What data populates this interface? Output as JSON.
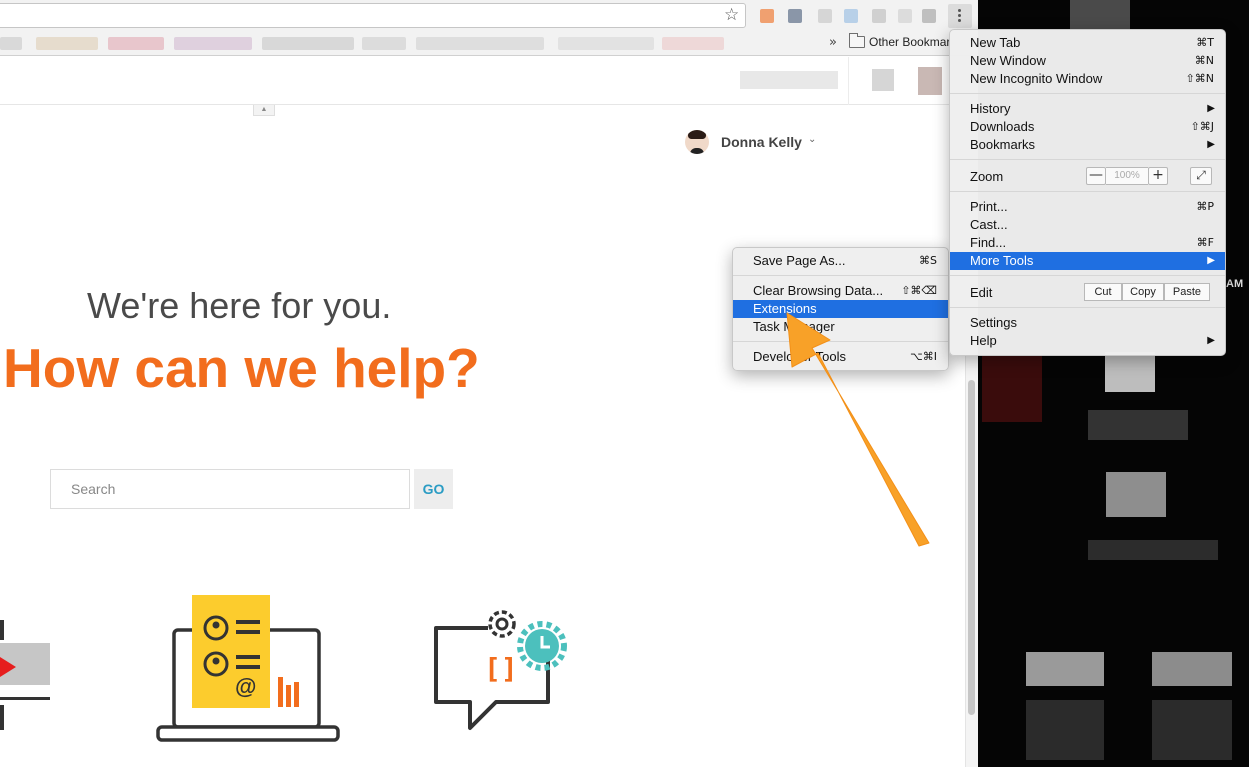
{
  "toolbar": {
    "star_icon": "star-icon",
    "more_icon": "vertical-dots-icon"
  },
  "bookmarks_bar": {
    "overflow": "»",
    "other_bookmarks": "Other Bookmarks"
  },
  "user": {
    "name": "Donna Kelly",
    "chevron": "⌄"
  },
  "hero": {
    "subtitle": "We're here for you.",
    "title": "How can we help?"
  },
  "search": {
    "placeholder": "Search",
    "go_label": "GO"
  },
  "main_menu": {
    "new_tab": {
      "label": "New Tab",
      "shortcut": "⌘T"
    },
    "new_window": {
      "label": "New Window",
      "shortcut": "⌘N"
    },
    "new_incognito": {
      "label": "New Incognito Window",
      "shortcut": "⇧⌘N"
    },
    "history": {
      "label": "History",
      "arrow": "▶"
    },
    "downloads": {
      "label": "Downloads",
      "shortcut": "⇧⌘J"
    },
    "bookmarks": {
      "label": "Bookmarks",
      "arrow": "▶"
    },
    "zoom": {
      "label": "Zoom",
      "minus": "—",
      "level": "100%",
      "plus": "+",
      "fullscreen": "⤢"
    },
    "print": {
      "label": "Print...",
      "shortcut": "⌘P"
    },
    "cast": {
      "label": "Cast..."
    },
    "find": {
      "label": "Find...",
      "shortcut": "⌘F"
    },
    "more_tools": {
      "label": "More Tools",
      "arrow": "▶"
    },
    "edit": {
      "label": "Edit",
      "cut": "Cut",
      "copy": "Copy",
      "paste": "Paste"
    },
    "settings": {
      "label": "Settings"
    },
    "help": {
      "label": "Help",
      "arrow": "▶"
    }
  },
  "more_tools_menu": {
    "save_page": {
      "label": "Save Page As...",
      "shortcut": "⌘S"
    },
    "clear_data": {
      "label": "Clear Browsing Data...",
      "shortcut": "⇧⌘⌫"
    },
    "extensions": {
      "label": "Extensions"
    },
    "task_manager": {
      "label": "Task Manager"
    },
    "developer_tools": {
      "label": "Developer Tools",
      "shortcut": "⌥⌘I"
    }
  },
  "side_fragments": {
    "am": "AM"
  },
  "colors": {
    "accent_orange": "#f26d1d",
    "go_blue": "#2a9cc4",
    "menu_selection": "#1f6fe1",
    "annotation_arrow": "#f8a128"
  }
}
